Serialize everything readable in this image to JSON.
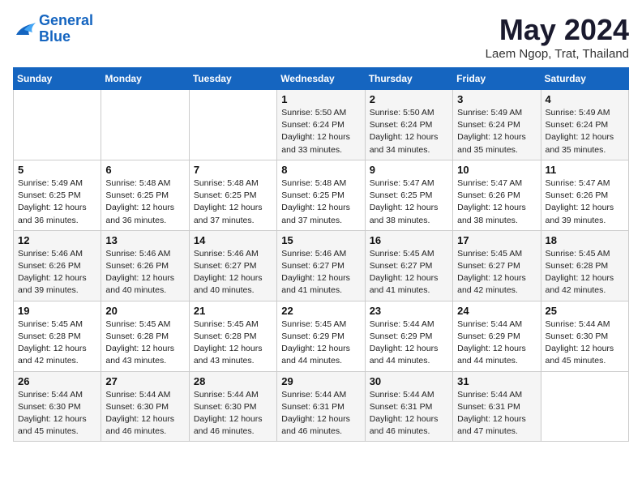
{
  "logo": {
    "line1": "General",
    "line2": "Blue"
  },
  "title": "May 2024",
  "subtitle": "Laem Ngop, Trat, Thailand",
  "days_of_week": [
    "Sunday",
    "Monday",
    "Tuesday",
    "Wednesday",
    "Thursday",
    "Friday",
    "Saturday"
  ],
  "weeks": [
    [
      {
        "num": "",
        "info": ""
      },
      {
        "num": "",
        "info": ""
      },
      {
        "num": "",
        "info": ""
      },
      {
        "num": "1",
        "info": "Sunrise: 5:50 AM\nSunset: 6:24 PM\nDaylight: 12 hours\nand 33 minutes."
      },
      {
        "num": "2",
        "info": "Sunrise: 5:50 AM\nSunset: 6:24 PM\nDaylight: 12 hours\nand 34 minutes."
      },
      {
        "num": "3",
        "info": "Sunrise: 5:49 AM\nSunset: 6:24 PM\nDaylight: 12 hours\nand 35 minutes."
      },
      {
        "num": "4",
        "info": "Sunrise: 5:49 AM\nSunset: 6:24 PM\nDaylight: 12 hours\nand 35 minutes."
      }
    ],
    [
      {
        "num": "5",
        "info": "Sunrise: 5:49 AM\nSunset: 6:25 PM\nDaylight: 12 hours\nand 36 minutes."
      },
      {
        "num": "6",
        "info": "Sunrise: 5:48 AM\nSunset: 6:25 PM\nDaylight: 12 hours\nand 36 minutes."
      },
      {
        "num": "7",
        "info": "Sunrise: 5:48 AM\nSunset: 6:25 PM\nDaylight: 12 hours\nand 37 minutes."
      },
      {
        "num": "8",
        "info": "Sunrise: 5:48 AM\nSunset: 6:25 PM\nDaylight: 12 hours\nand 37 minutes."
      },
      {
        "num": "9",
        "info": "Sunrise: 5:47 AM\nSunset: 6:25 PM\nDaylight: 12 hours\nand 38 minutes."
      },
      {
        "num": "10",
        "info": "Sunrise: 5:47 AM\nSunset: 6:26 PM\nDaylight: 12 hours\nand 38 minutes."
      },
      {
        "num": "11",
        "info": "Sunrise: 5:47 AM\nSunset: 6:26 PM\nDaylight: 12 hours\nand 39 minutes."
      }
    ],
    [
      {
        "num": "12",
        "info": "Sunrise: 5:46 AM\nSunset: 6:26 PM\nDaylight: 12 hours\nand 39 minutes."
      },
      {
        "num": "13",
        "info": "Sunrise: 5:46 AM\nSunset: 6:26 PM\nDaylight: 12 hours\nand 40 minutes."
      },
      {
        "num": "14",
        "info": "Sunrise: 5:46 AM\nSunset: 6:27 PM\nDaylight: 12 hours\nand 40 minutes."
      },
      {
        "num": "15",
        "info": "Sunrise: 5:46 AM\nSunset: 6:27 PM\nDaylight: 12 hours\nand 41 minutes."
      },
      {
        "num": "16",
        "info": "Sunrise: 5:45 AM\nSunset: 6:27 PM\nDaylight: 12 hours\nand 41 minutes."
      },
      {
        "num": "17",
        "info": "Sunrise: 5:45 AM\nSunset: 6:27 PM\nDaylight: 12 hours\nand 42 minutes."
      },
      {
        "num": "18",
        "info": "Sunrise: 5:45 AM\nSunset: 6:28 PM\nDaylight: 12 hours\nand 42 minutes."
      }
    ],
    [
      {
        "num": "19",
        "info": "Sunrise: 5:45 AM\nSunset: 6:28 PM\nDaylight: 12 hours\nand 42 minutes."
      },
      {
        "num": "20",
        "info": "Sunrise: 5:45 AM\nSunset: 6:28 PM\nDaylight: 12 hours\nand 43 minutes."
      },
      {
        "num": "21",
        "info": "Sunrise: 5:45 AM\nSunset: 6:28 PM\nDaylight: 12 hours\nand 43 minutes."
      },
      {
        "num": "22",
        "info": "Sunrise: 5:45 AM\nSunset: 6:29 PM\nDaylight: 12 hours\nand 44 minutes."
      },
      {
        "num": "23",
        "info": "Sunrise: 5:44 AM\nSunset: 6:29 PM\nDaylight: 12 hours\nand 44 minutes."
      },
      {
        "num": "24",
        "info": "Sunrise: 5:44 AM\nSunset: 6:29 PM\nDaylight: 12 hours\nand 44 minutes."
      },
      {
        "num": "25",
        "info": "Sunrise: 5:44 AM\nSunset: 6:30 PM\nDaylight: 12 hours\nand 45 minutes."
      }
    ],
    [
      {
        "num": "26",
        "info": "Sunrise: 5:44 AM\nSunset: 6:30 PM\nDaylight: 12 hours\nand 45 minutes."
      },
      {
        "num": "27",
        "info": "Sunrise: 5:44 AM\nSunset: 6:30 PM\nDaylight: 12 hours\nand 46 minutes."
      },
      {
        "num": "28",
        "info": "Sunrise: 5:44 AM\nSunset: 6:30 PM\nDaylight: 12 hours\nand 46 minutes."
      },
      {
        "num": "29",
        "info": "Sunrise: 5:44 AM\nSunset: 6:31 PM\nDaylight: 12 hours\nand 46 minutes."
      },
      {
        "num": "30",
        "info": "Sunrise: 5:44 AM\nSunset: 6:31 PM\nDaylight: 12 hours\nand 46 minutes."
      },
      {
        "num": "31",
        "info": "Sunrise: 5:44 AM\nSunset: 6:31 PM\nDaylight: 12 hours\nand 47 minutes."
      },
      {
        "num": "",
        "info": ""
      }
    ]
  ]
}
